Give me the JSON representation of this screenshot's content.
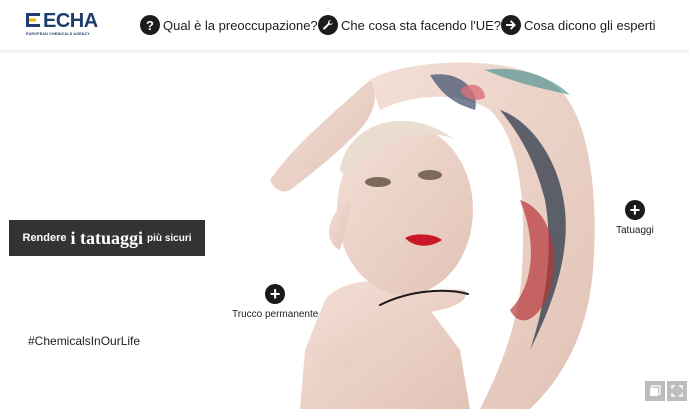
{
  "logo": {
    "name": "ECHA",
    "subtitle": "EUROPEAN CHEMICALS AGENCY"
  },
  "nav": [
    {
      "icon": "question-icon",
      "glyph": "?",
      "label": "Qual è la preoccupazione?"
    },
    {
      "icon": "wrench-icon",
      "glyph": "",
      "label": "Che cosa sta facendo l'UE?"
    },
    {
      "icon": "arrow-right-icon",
      "glyph": "➜",
      "label": "Cosa dicono gli esperti"
    }
  ],
  "banner": {
    "part1": "Rendere",
    "part2": "i tatuaggi",
    "part3": "più sicuri"
  },
  "hotspots": [
    {
      "label": "Tatuaggi"
    },
    {
      "label": "Trucco permanente"
    }
  ],
  "hashtag": "#ChemicalsInOurLife",
  "colors": {
    "brand": "#1e3e6b",
    "banner_bg": "#333333",
    "hotspot": "#1a1a1a"
  }
}
